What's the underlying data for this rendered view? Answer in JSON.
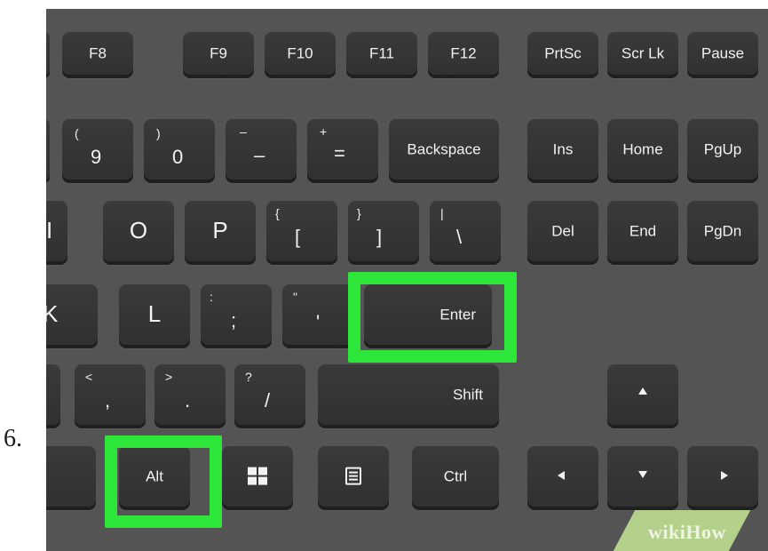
{
  "step": {
    "number": "6."
  },
  "colors": {
    "highlight": "#2ee639",
    "background": "#545454",
    "key": "#333333",
    "watermark": "#b4d18b"
  },
  "keys": {
    "f8": "F8",
    "f9": "F9",
    "f10": "F10",
    "f11": "F11",
    "f12": "F12",
    "prtsc": "PrtSc",
    "scrlk": "Scr Lk",
    "pause": "Pause",
    "nine": {
      "main": "9",
      "sub": "("
    },
    "zero": {
      "main": "0",
      "sub": ")"
    },
    "minus": {
      "main": "–",
      "sub": "–"
    },
    "equals": {
      "main": "=",
      "sub": "+"
    },
    "backspace": "Backspace",
    "ins": "Ins",
    "home": "Home",
    "pgup": "PgUp",
    "i": "I",
    "o": "O",
    "p": "P",
    "lbracket": {
      "main": "[",
      "sub": "{"
    },
    "rbracket": {
      "main": "]",
      "sub": "}"
    },
    "backslash": {
      "main": "\\",
      "sub": "|"
    },
    "del": "Del",
    "end": "End",
    "pgdn": "PgDn",
    "k": "K",
    "l": "L",
    "semicolon": {
      "main": ";",
      "sub": ":"
    },
    "quote": {
      "main": "'",
      "sub": "\""
    },
    "enter": "Enter",
    "comma": {
      "main": ",",
      "sub": "<"
    },
    "period": {
      "main": ".",
      "sub": ">"
    },
    "slash": {
      "main": "/",
      "sub": "?"
    },
    "shift": "Shift",
    "alt": "Alt",
    "ctrl": "Ctrl",
    "windows": "windows-logo-icon",
    "menu": "menu-icon",
    "arrows": [
      "arrow-up-icon",
      "arrow-left-icon",
      "arrow-down-icon",
      "arrow-right-icon"
    ]
  },
  "highlighted_keys": [
    "Enter",
    "Alt"
  ],
  "watermark": {
    "prefix": "wiki",
    "suffix": "How"
  }
}
